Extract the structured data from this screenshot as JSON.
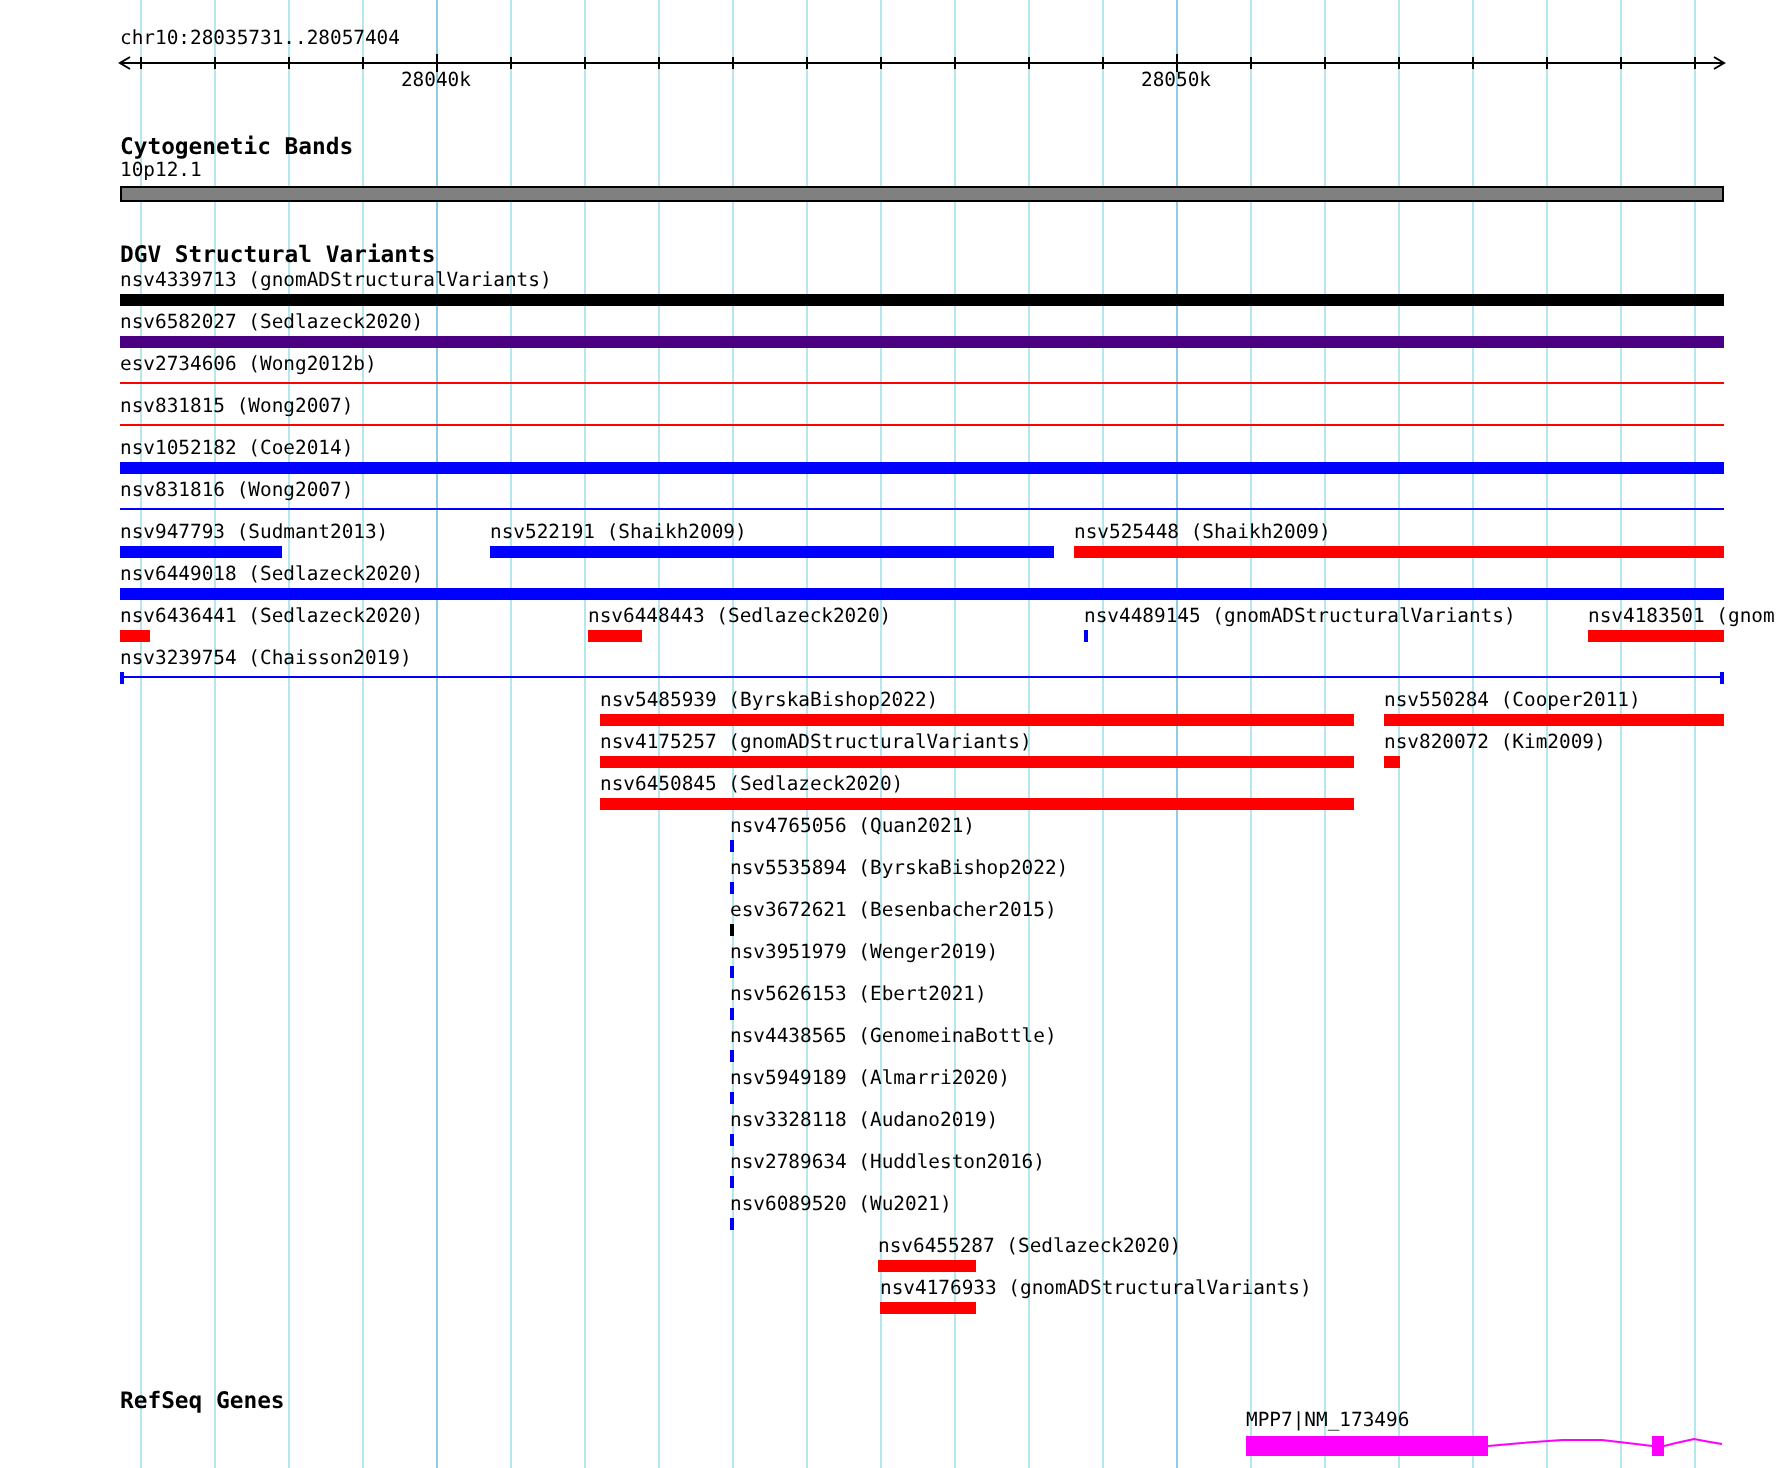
{
  "ruler": {
    "location": "chr10:28035731..28057404",
    "ticks": [
      "28040k",
      "28050k"
    ]
  },
  "cytoband_track": {
    "title": "Cytogenetic Bands",
    "band": {
      "label": "10p12.1"
    }
  },
  "dgv_track": {
    "title": "DGV Structural Variants",
    "rows": [
      [
        {
          "label": "nsv4339713 (gnomADStructuralVariants)",
          "kind": "bar",
          "color": "#000000"
        }
      ],
      [
        {
          "label": "nsv6582027 (Sedlazeck2020)",
          "kind": "bar",
          "color": "#4b0082"
        }
      ],
      [
        {
          "label": "esv2734606 (Wong2012b)",
          "kind": "line",
          "color": "#ff0000"
        }
      ],
      [
        {
          "label": "nsv831815 (Wong2007)",
          "kind": "line",
          "color": "#ff0000"
        }
      ],
      [
        {
          "label": "nsv1052182 (Coe2014)",
          "kind": "bar",
          "color": "#0000ff"
        }
      ],
      [
        {
          "label": "nsv831816 (Wong2007)",
          "kind": "line",
          "color": "#0000ff"
        }
      ],
      [
        {
          "label": "nsv947793 (Sudmant2013)",
          "kind": "bar",
          "color": "#0000ff"
        },
        {
          "label": "nsv522191 (Shaikh2009)",
          "kind": "bar",
          "color": "#0000ff"
        },
        {
          "label": "nsv525448 (Shaikh2009)",
          "kind": "bar",
          "color": "#ff0000"
        }
      ],
      [
        {
          "label": "nsv6449018 (Sedlazeck2020)",
          "kind": "bar",
          "color": "#0000ff"
        }
      ],
      [
        {
          "label": "nsv6436441 (Sedlazeck2020)",
          "kind": "bar",
          "color": "#ff0000"
        },
        {
          "label": "nsv6448443 (Sedlazeck2020)",
          "kind": "bar",
          "color": "#ff0000"
        },
        {
          "label": "nsv4489145 (gnomADStructuralVariants)",
          "kind": "bar",
          "color": "#0000ff"
        },
        {
          "label": "nsv4183501 (gnom",
          "kind": "bar",
          "color": "#ff0000"
        }
      ],
      [
        {
          "label": "nsv3239754 (Chaisson2019)",
          "kind": "capped-line",
          "color": "#0000ff"
        }
      ],
      [
        {
          "label": "nsv5485939 (ByrskaBishop2022)",
          "kind": "bar",
          "color": "#ff0000"
        },
        {
          "label": "nsv550284 (Cooper2011)",
          "kind": "bar",
          "color": "#ff0000"
        }
      ],
      [
        {
          "label": "nsv4175257 (gnomADStructuralVariants)",
          "kind": "bar",
          "color": "#ff0000"
        },
        {
          "label": "nsv820072 (Kim2009)",
          "kind": "bar",
          "color": "#ff0000"
        }
      ],
      [
        {
          "label": "nsv6450845 (Sedlazeck2020)",
          "kind": "bar",
          "color": "#ff0000"
        }
      ],
      [
        {
          "label": "nsv4765056 (Quan2021)",
          "kind": "bar",
          "color": "#0000ff"
        }
      ],
      [
        {
          "label": "nsv5535894 (ByrskaBishop2022)",
          "kind": "bar",
          "color": "#0000ff"
        }
      ],
      [
        {
          "label": "esv3672621 (Besenbacher2015)",
          "kind": "bar",
          "color": "#000000"
        }
      ],
      [
        {
          "label": "nsv3951979 (Wenger2019)",
          "kind": "bar",
          "color": "#0000ff"
        }
      ],
      [
        {
          "label": "nsv5626153 (Ebert2021)",
          "kind": "bar",
          "color": "#0000ff"
        }
      ],
      [
        {
          "label": "nsv4438565 (GenomeinaBottle)",
          "kind": "bar",
          "color": "#0000ff"
        }
      ],
      [
        {
          "label": "nsv5949189 (Almarri2020)",
          "kind": "bar",
          "color": "#0000ff"
        }
      ],
      [
        {
          "label": "nsv3328118 (Audano2019)",
          "kind": "bar",
          "color": "#0000ff"
        }
      ],
      [
        {
          "label": "nsv2789634 (Huddleston2016)",
          "kind": "bar",
          "color": "#0000ff"
        }
      ],
      [
        {
          "label": "nsv6089520 (Wu2021)",
          "kind": "bar",
          "color": "#0000ff"
        }
      ],
      [
        {
          "label": "nsv6455287 (Sedlazeck2020)",
          "kind": "bar",
          "color": "#ff0000"
        }
      ],
      [
        {
          "label": "nsv4176933 (gnomADStructuralVariants)",
          "kind": "bar",
          "color": "#ff0000"
        }
      ]
    ]
  },
  "refseq_track": {
    "title": "RefSeq Genes",
    "genes": [
      {
        "label": "MPP7|NM_173496"
      }
    ]
  }
}
